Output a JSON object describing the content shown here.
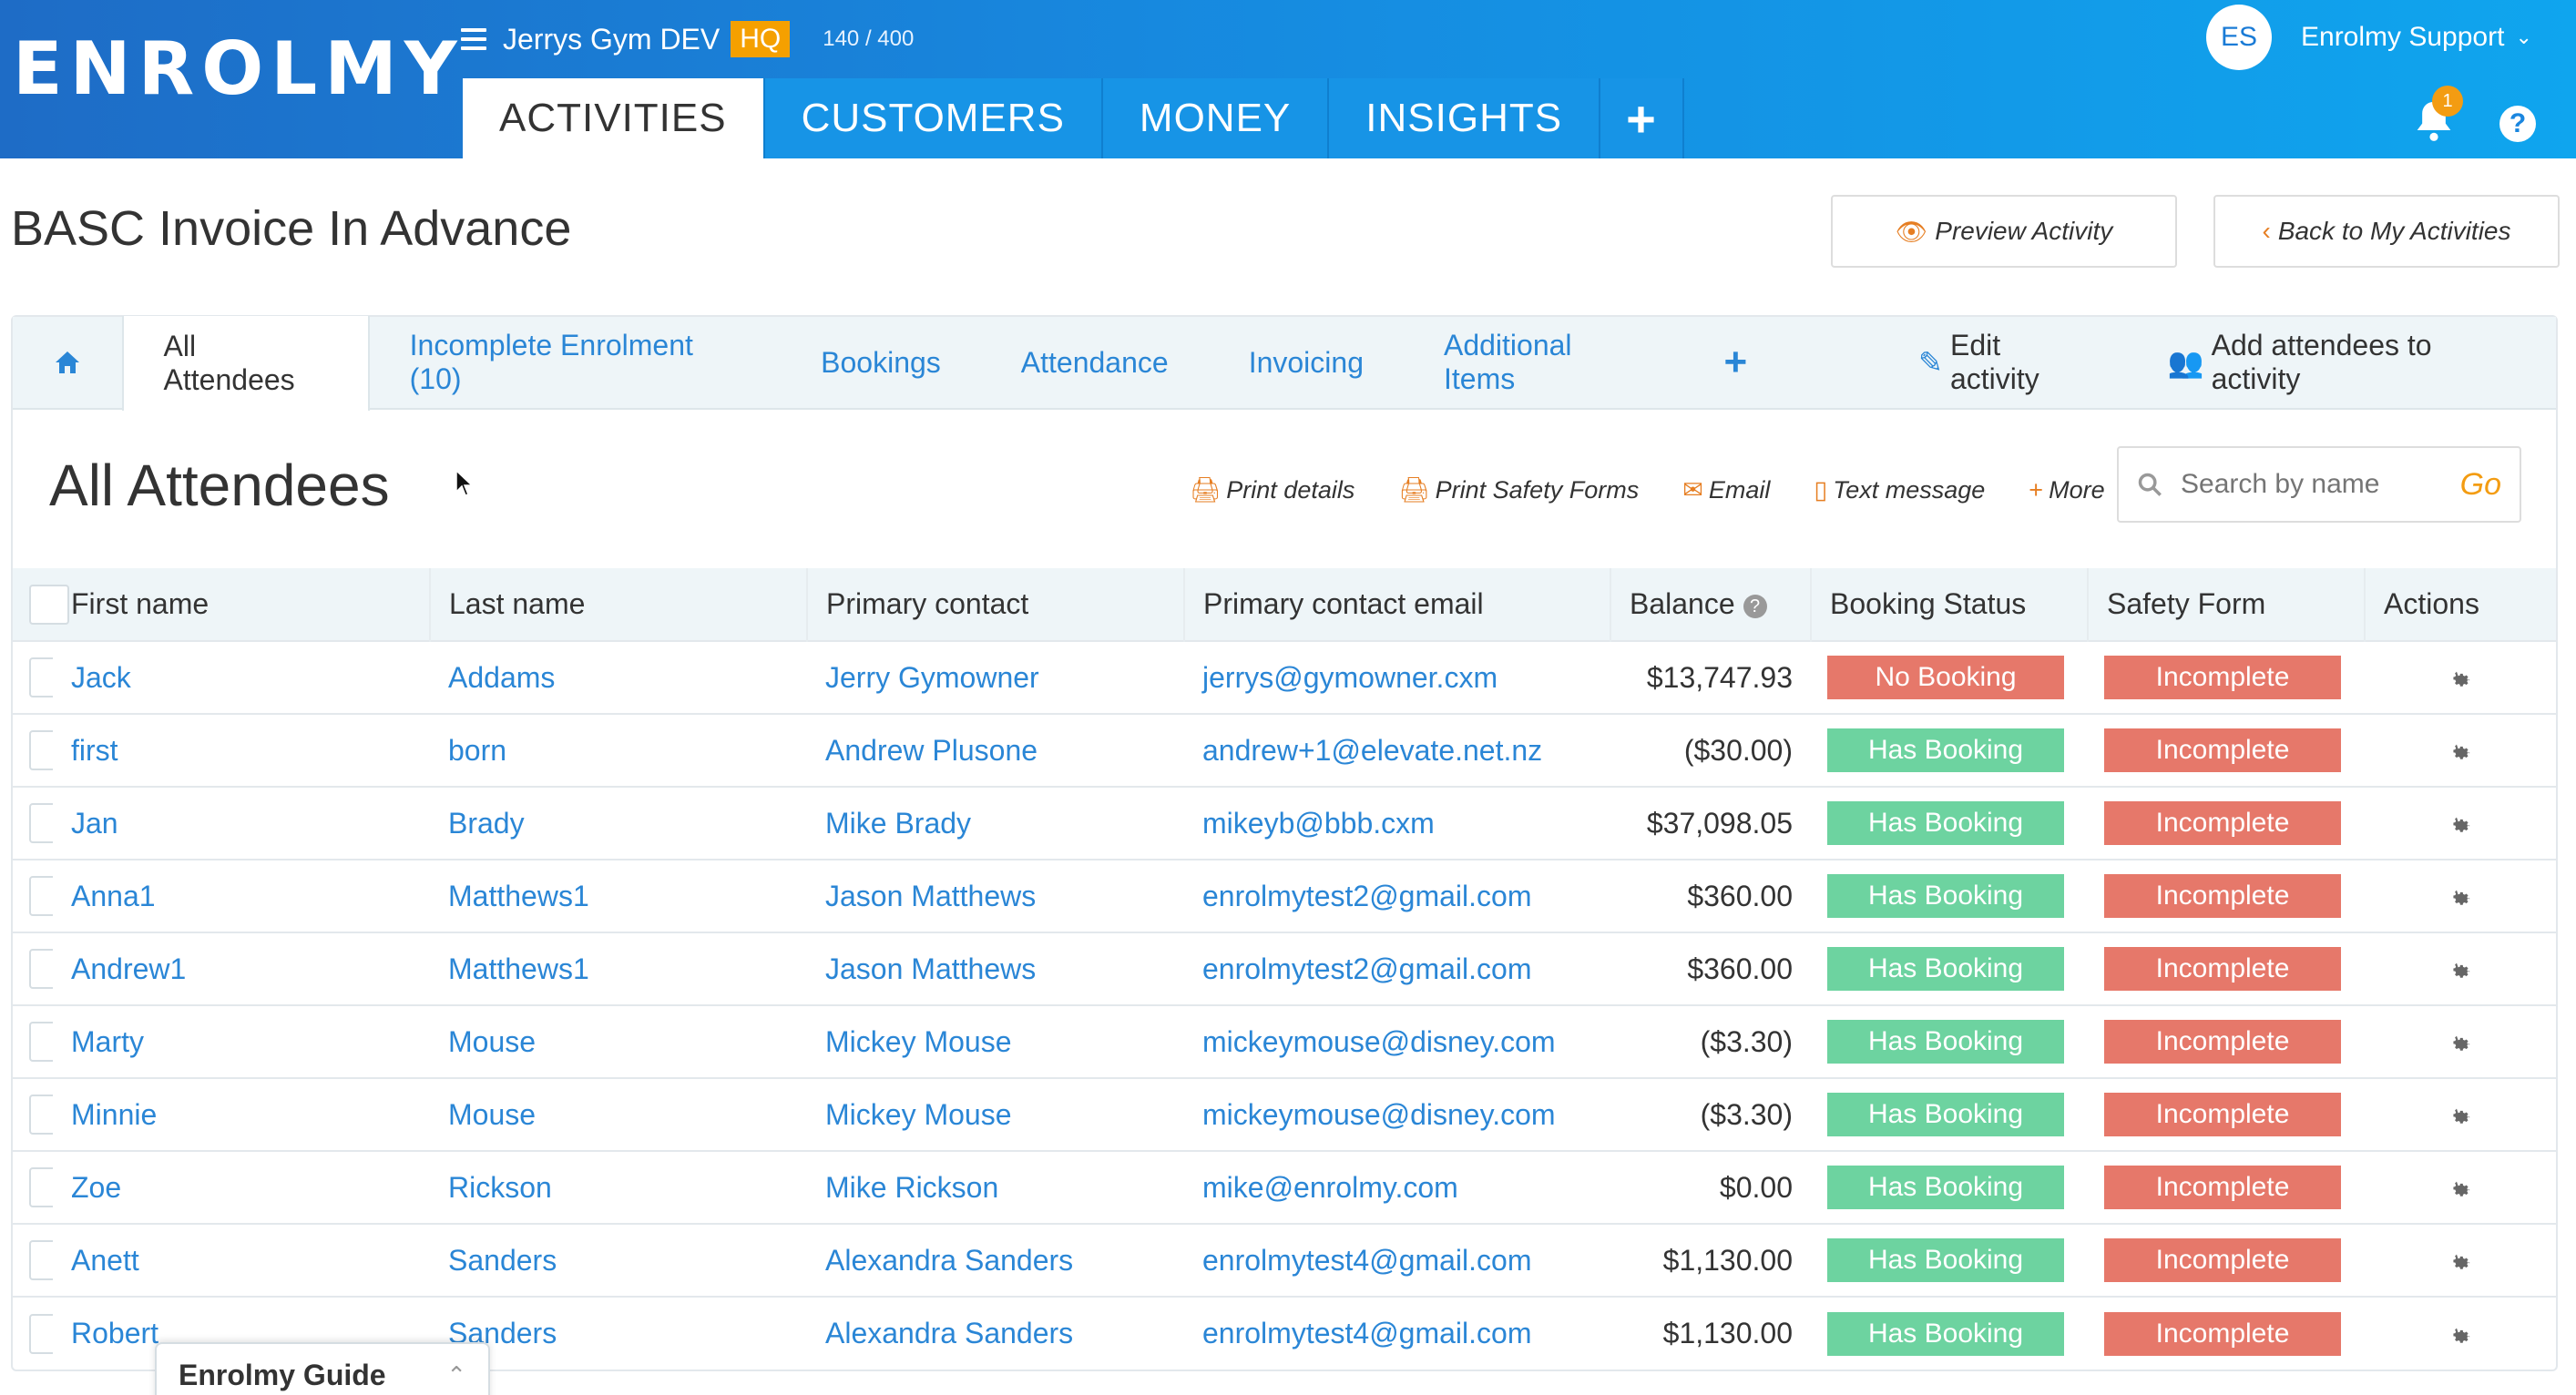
{
  "header": {
    "logo": "ENROLMY",
    "org_name": "Jerrys Gym DEV",
    "hq_badge": "HQ",
    "counter": "140 / 400",
    "tabs": [
      {
        "label": "ACTIVITIES",
        "active": true
      },
      {
        "label": "CUSTOMERS"
      },
      {
        "label": "MONEY"
      },
      {
        "label": "INSIGHTS"
      }
    ],
    "user_initials": "ES",
    "user_name": "Enrolmy Support",
    "notification_count": "1",
    "help_label": "?"
  },
  "page": {
    "title": "BASC Invoice In Advance",
    "preview_button": "Preview Activity",
    "back_button": "Back to My Activities"
  },
  "sub_tabs": {
    "all_attendees": "All Attendees",
    "incomplete": "Incomplete Enrolment (10)",
    "bookings": "Bookings",
    "attendance": "Attendance",
    "invoicing": "Invoicing",
    "additional_items": "Additional Items",
    "edit_activity": "Edit activity",
    "add_attendees": "Add attendees to activity"
  },
  "section": {
    "title": "All Attendees",
    "tools": {
      "print_details": "Print details",
      "print_safety": "Print Safety Forms",
      "email": "Email",
      "text": "Text message",
      "more": "More"
    },
    "search_placeholder": "Search by name",
    "search_go": "Go"
  },
  "table": {
    "columns": [
      "First name",
      "Last name",
      "Primary contact",
      "Primary contact email",
      "Balance",
      "Booking Status",
      "Safety Form",
      "Actions"
    ],
    "rows": [
      {
        "first": "Jack",
        "last": "Addams",
        "contact": "Jerry Gymowner",
        "email": "jerrys@gymowner.cxm",
        "balance": "$13,747.93",
        "booking": "No Booking",
        "safety": "Incomplete"
      },
      {
        "first": "first",
        "last": "born",
        "contact": "Andrew Plusone",
        "email": "andrew+1@elevate.net.nz",
        "balance": "($30.00)",
        "booking": "Has Booking",
        "safety": "Incomplete"
      },
      {
        "first": "Jan",
        "last": "Brady",
        "contact": "Mike Brady",
        "email": "mikeyb@bbb.cxm",
        "balance": "$37,098.05",
        "booking": "Has Booking",
        "safety": "Incomplete"
      },
      {
        "first": "Anna1",
        "last": "Matthews1",
        "contact": "Jason Matthews",
        "email": "enrolmytest2@gmail.com",
        "balance": "$360.00",
        "booking": "Has Booking",
        "safety": "Incomplete"
      },
      {
        "first": "Andrew1",
        "last": "Matthews1",
        "contact": "Jason Matthews",
        "email": "enrolmytest2@gmail.com",
        "balance": "$360.00",
        "booking": "Has Booking",
        "safety": "Incomplete"
      },
      {
        "first": "Marty",
        "last": "Mouse",
        "contact": "Mickey Mouse",
        "email": "mickeymouse@disney.com",
        "balance": "($3.30)",
        "booking": "Has Booking",
        "safety": "Incomplete"
      },
      {
        "first": "Minnie",
        "last": "Mouse",
        "contact": "Mickey Mouse",
        "email": "mickeymouse@disney.com",
        "balance": "($3.30)",
        "booking": "Has Booking",
        "safety": "Incomplete"
      },
      {
        "first": "Zoe",
        "last": "Rickson",
        "contact": "Mike Rickson",
        "email": "mike@enrolmy.com",
        "balance": "$0.00",
        "booking": "Has Booking",
        "safety": "Incomplete"
      },
      {
        "first": "Anett",
        "last": "Sanders",
        "contact": "Alexandra Sanders",
        "email": "enrolmytest4@gmail.com",
        "balance": "$1,130.00",
        "booking": "Has Booking",
        "safety": "Incomplete"
      },
      {
        "first": "Robert",
        "last": "Sanders",
        "contact": "Alexandra Sanders",
        "email": "enrolmytest4@gmail.com",
        "balance": "$1,130.00",
        "booking": "Has Booking",
        "safety": "Incomplete"
      }
    ]
  },
  "guide": {
    "label": "Enrolmy Guide"
  },
  "colors": {
    "brand_blue": "#1789df",
    "accent_orange": "#f39c12",
    "danger": "#e6786a",
    "success": "#6dd3a0",
    "link": "#2a86d6"
  }
}
